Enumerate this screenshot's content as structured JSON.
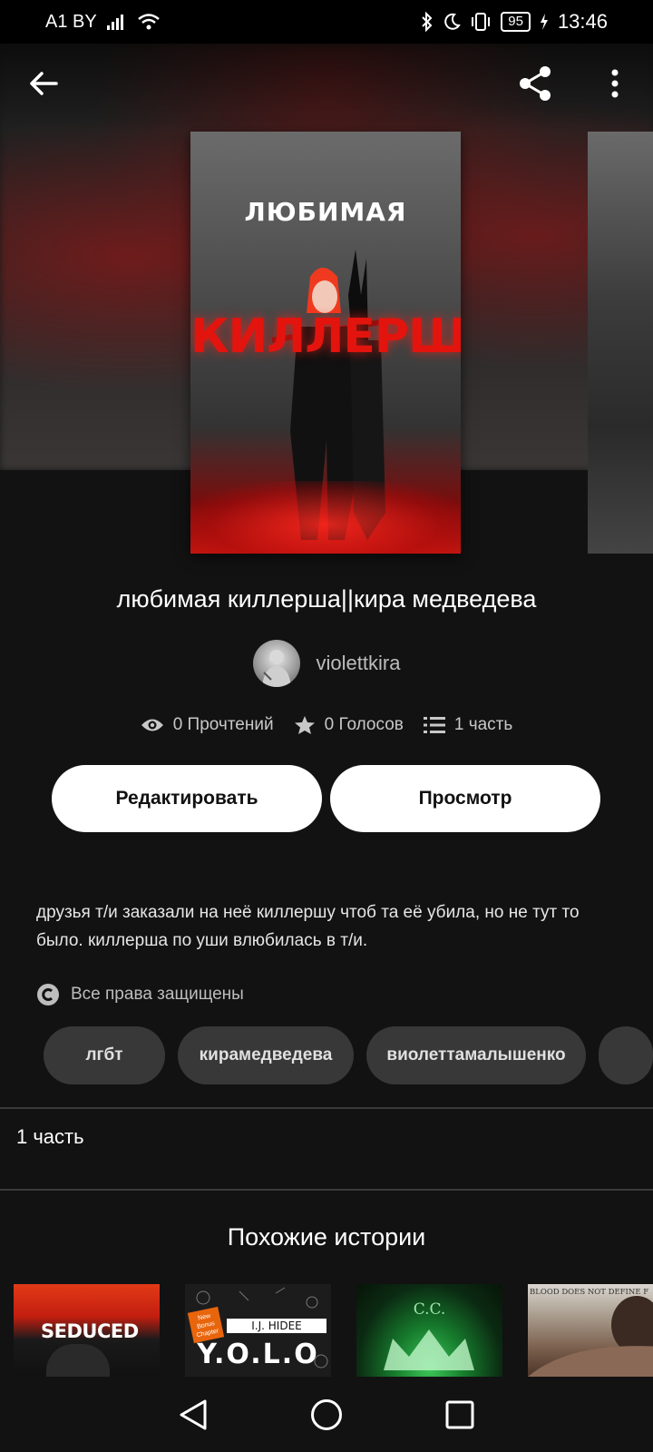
{
  "status_bar": {
    "carrier": "A1 BY",
    "battery": "95",
    "time": "13:46"
  },
  "story": {
    "cover_top_text": "ЛЮБИМАЯ",
    "cover_main_text": "КИЛЛЕРША",
    "title": "любимая киллерша||кира медведева",
    "author": "violettkira",
    "reads": "0 Прочтений",
    "votes": "0 Голосов",
    "parts": "1 часть",
    "description": "друзья т/и заказали на неё киллершу чтоб та её убила, но не тут то было. киллерша по уши влюбилась в т/и.",
    "rights": "Все права защищены"
  },
  "actions": {
    "edit_label": "Редактировать",
    "view_label": "Просмотр"
  },
  "tags": [
    "лгбт",
    "кирамедведева",
    "виолеттамалышенко",
    ""
  ],
  "parts_row": "1 часть",
  "similar": {
    "title": "Похожие истории",
    "covers": [
      {
        "text": "SEDUCED"
      },
      {
        "badge": "New Bonus Chapter",
        "author": "I.J. HIDEE",
        "text": "Y.O.L.O"
      },
      {
        "text": "C.C."
      },
      {
        "text": "BLOOD DOES NOT DEFINE F"
      }
    ]
  }
}
